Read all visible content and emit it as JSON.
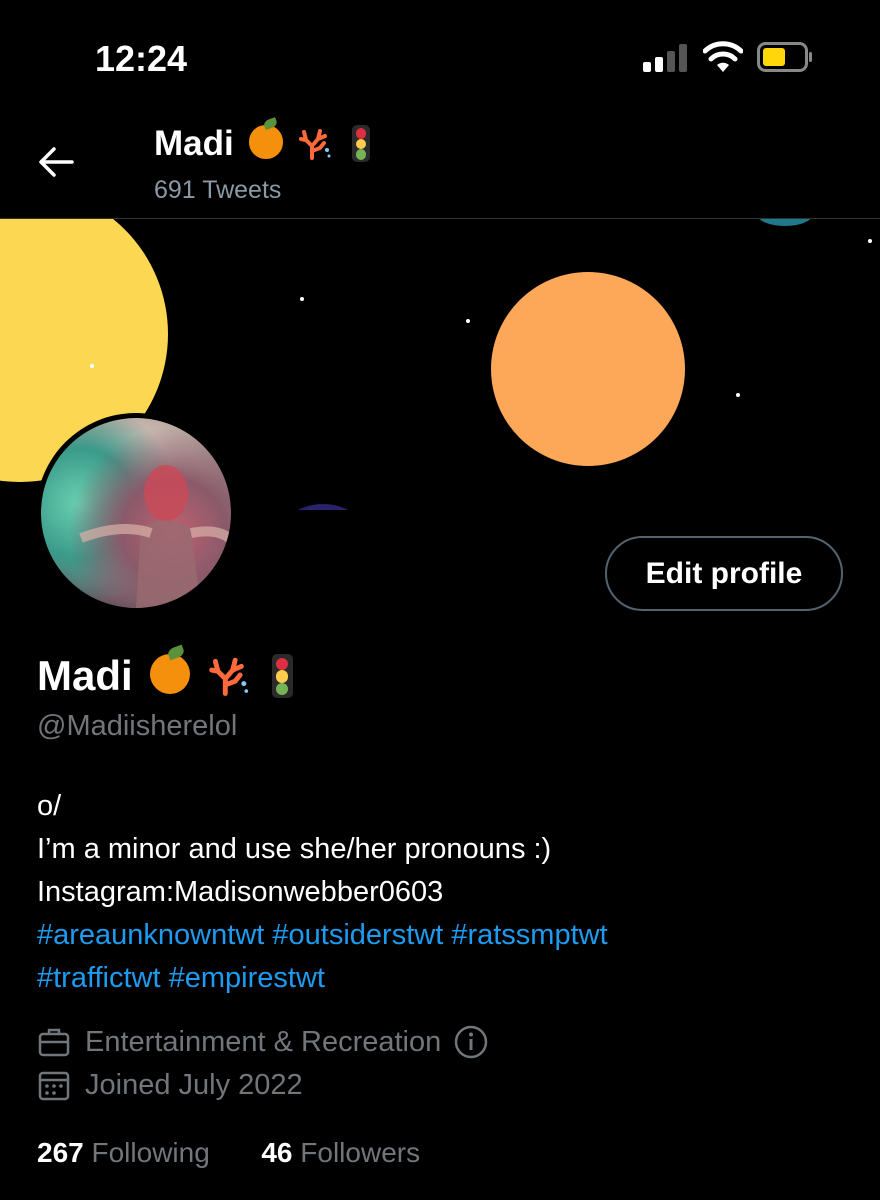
{
  "status_bar": {
    "time": "12:24"
  },
  "header": {
    "name": "Madi",
    "tweet_count": "691 Tweets"
  },
  "profile": {
    "display_name": "Madi",
    "handle": "@Madiisherelol",
    "edit_button": "Edit profile",
    "bio_lines": [
      "o/",
      "I’m a minor and use she/her pronouns :)",
      "Instagram:Madisonwebber0603"
    ],
    "hashtags_line1": [
      "#areaunknowntwt",
      "#outsiderstwt",
      "#ratssmptwt"
    ],
    "hashtags_line2": [
      "#traffictwt",
      "#empirestwt"
    ],
    "category": "Entertainment & Recreation",
    "joined": "Joined July 2022",
    "following_count": "267",
    "following_label": "Following",
    "followers_count": "46",
    "followers_label": "Followers"
  },
  "icons": {
    "back": "arrow-left-icon",
    "category": "briefcase-icon",
    "info": "info-icon",
    "joined": "calendar-icon"
  },
  "colors": {
    "background": "#000000",
    "accent_link": "#1d9bf0",
    "secondary_text": "#71767b",
    "banner_yellow": "#fcd752",
    "banner_orange": "#fca858",
    "banner_navy": "#28236a",
    "banner_teal": "#1e7a8a"
  }
}
